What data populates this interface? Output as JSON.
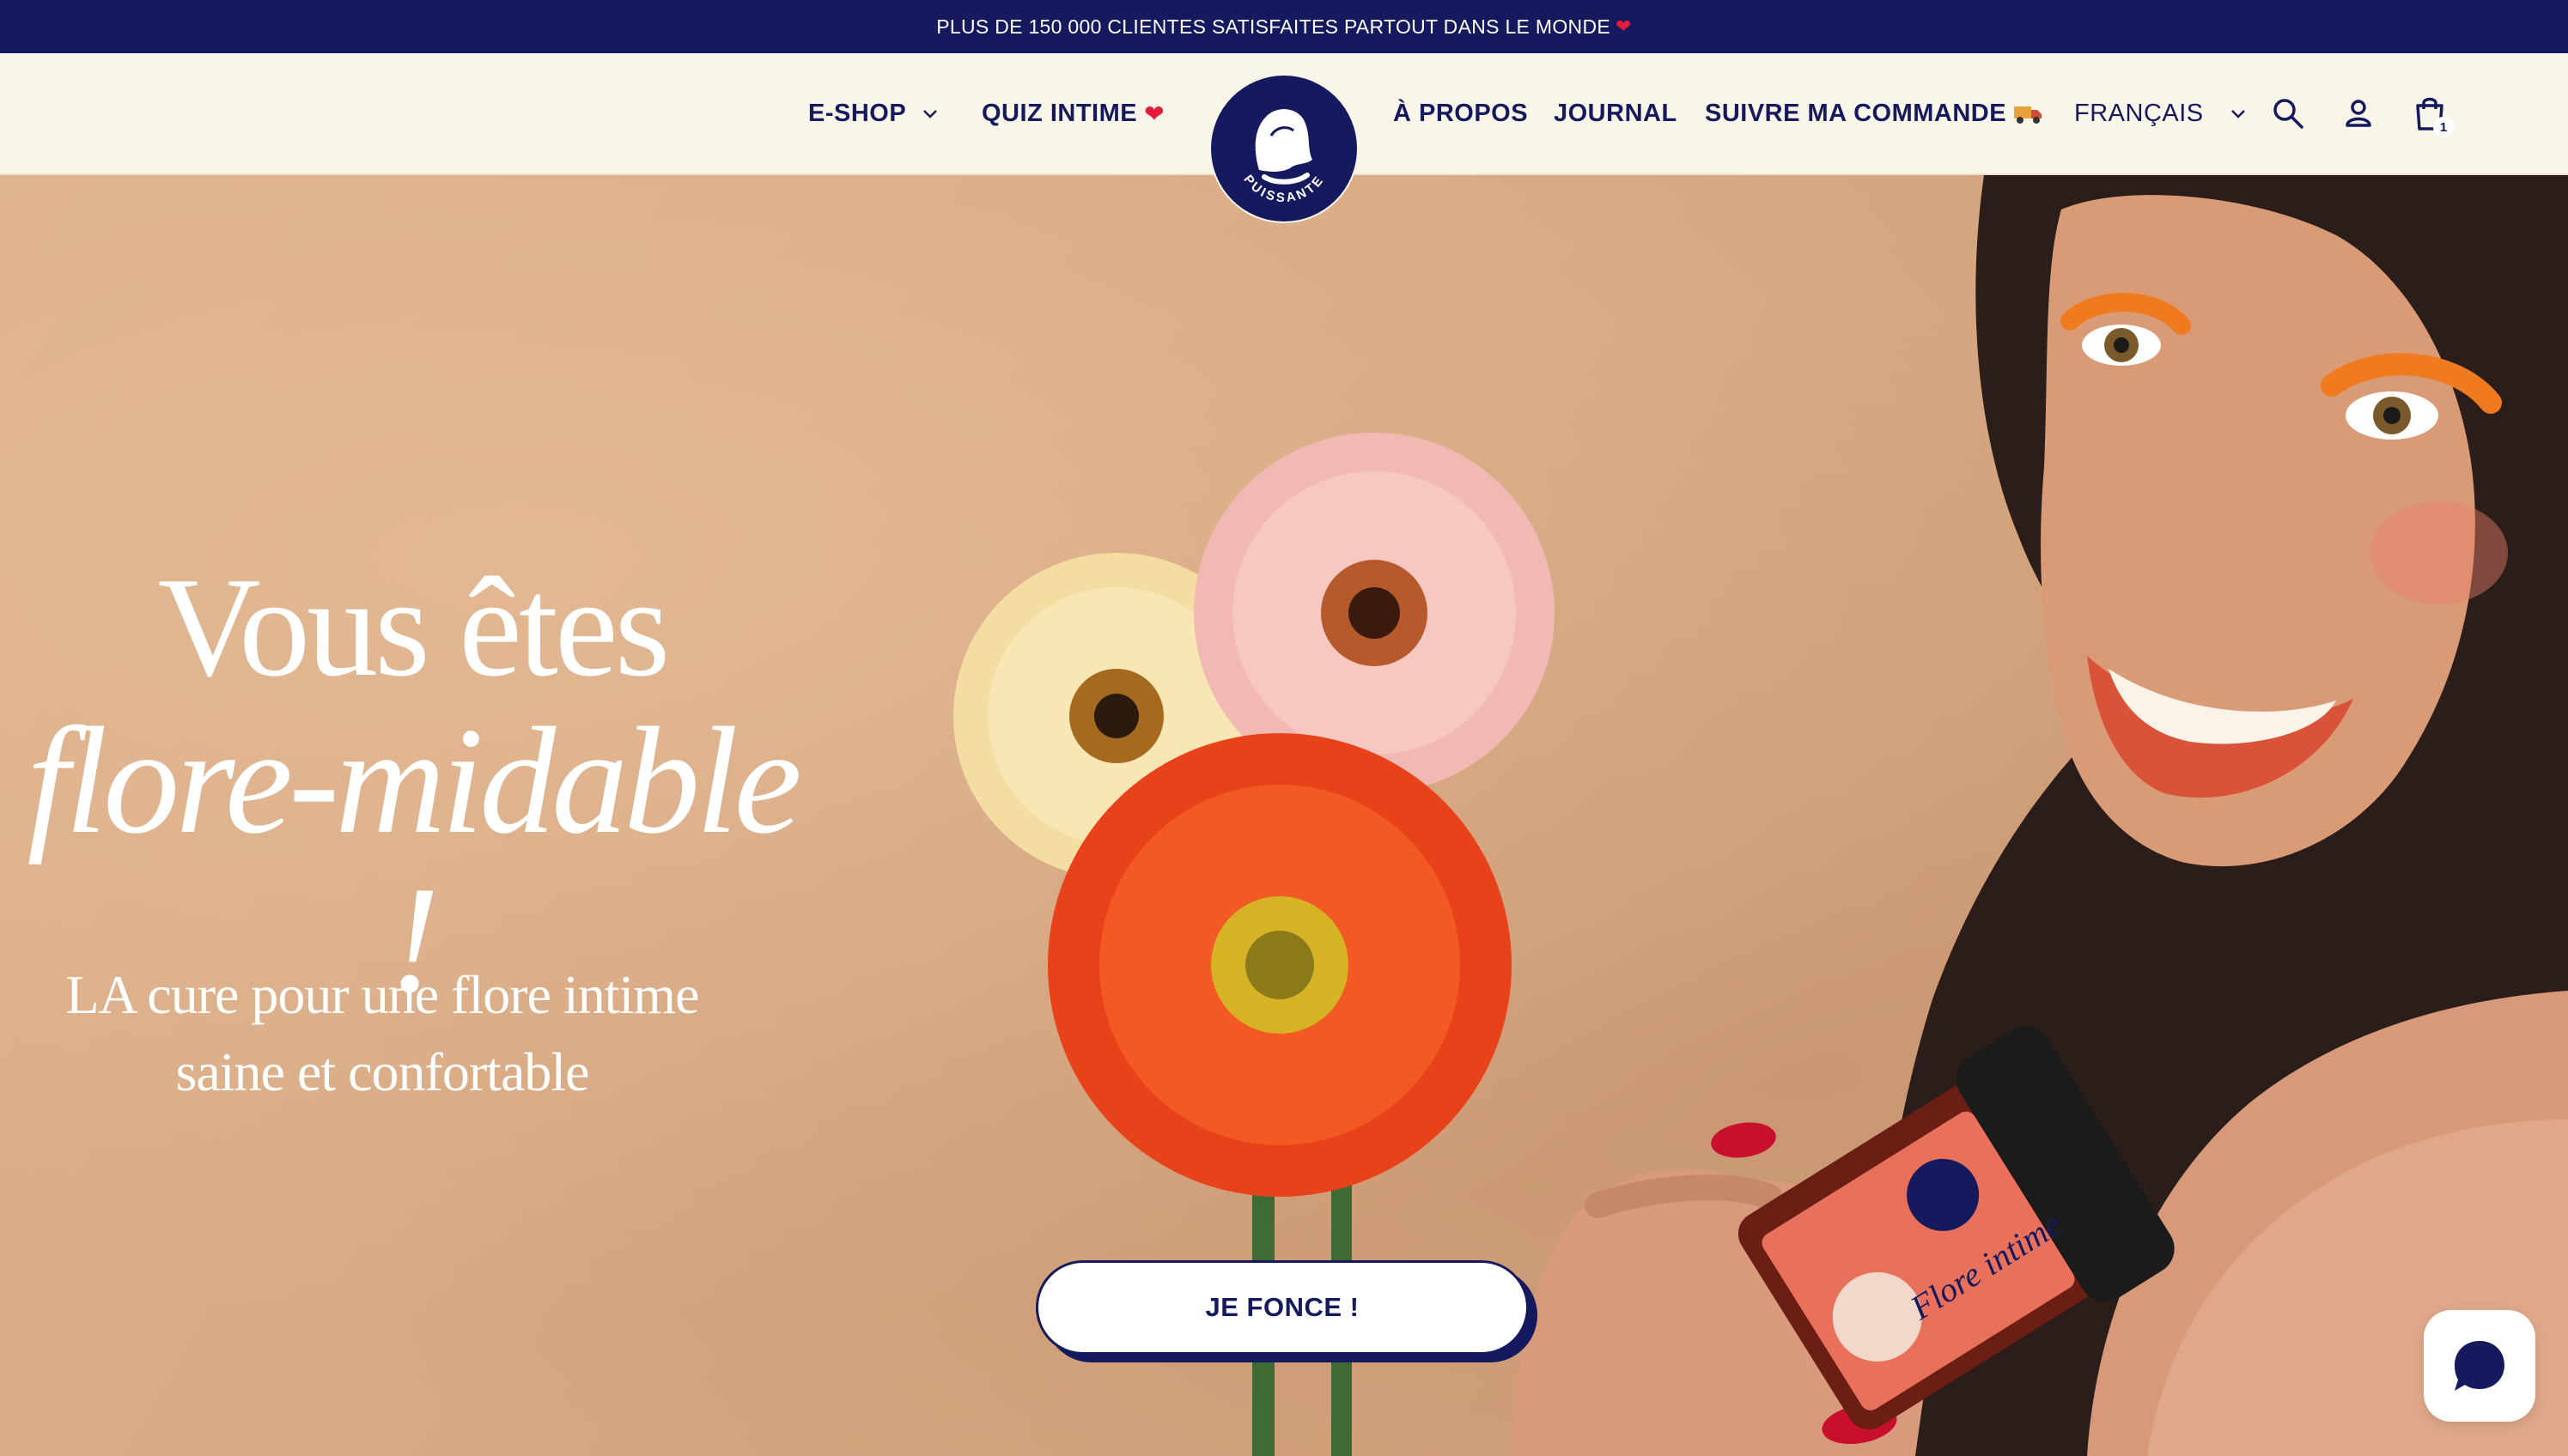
{
  "announcement": {
    "text": "PLUS DE 150 000 CLIENTES SATISFAITES PARTOUT DANS LE MONDE",
    "icon": "heart-icon"
  },
  "nav": {
    "eshop": "E-SHOP",
    "quiz": "QUIZ INTIME",
    "about": "À PROPOS",
    "journal": "JOURNAL",
    "track": "SUIVRE MA COMMANDE",
    "language": "FRANÇAIS",
    "cart_count": "1",
    "logo_text": "PUISSANTE"
  },
  "hero": {
    "title_line1": "Vous êtes",
    "title_line2": "flore-midable !",
    "subtitle_line1": "LA cure pour une flore intime",
    "subtitle_line2": "saine et confortable",
    "cta": "JE FONCE !",
    "product_label": "Flore intime"
  },
  "colors": {
    "brand_navy": "#15195e",
    "cream": "#faf5e9",
    "background_peach": "#d8ab85",
    "heart_red": "#e31b3a"
  }
}
